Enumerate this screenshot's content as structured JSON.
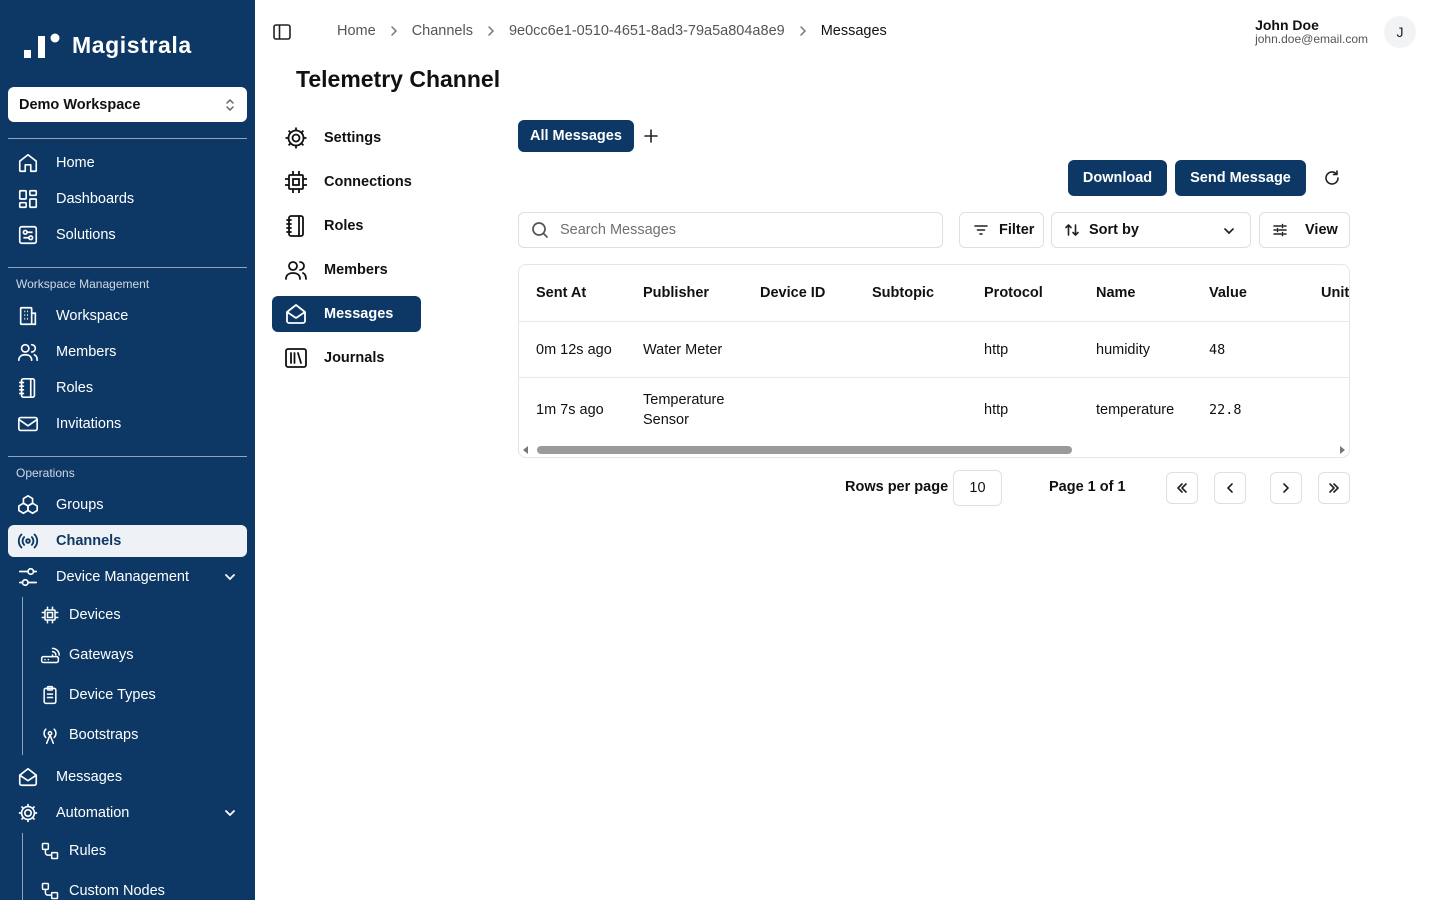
{
  "app": {
    "name": "Magistrala"
  },
  "workspace": {
    "selected": "Demo Workspace"
  },
  "sidebar": {
    "main_items": [
      {
        "label": "Home",
        "icon": "home-icon"
      },
      {
        "label": "Dashboards",
        "icon": "dashboards-icon"
      },
      {
        "label": "Solutions",
        "icon": "solutions-icon"
      }
    ],
    "workspace_section": "Workspace Management",
    "workspace_items": [
      {
        "label": "Workspace",
        "icon": "building-icon"
      },
      {
        "label": "Members",
        "icon": "users-icon"
      },
      {
        "label": "Roles",
        "icon": "notebook-icon"
      },
      {
        "label": "Invitations",
        "icon": "mail-icon"
      }
    ],
    "operations_section": "Operations",
    "operations_items": [
      {
        "label": "Groups",
        "icon": "boxes-icon"
      },
      {
        "label": "Channels",
        "icon": "radio-icon",
        "active": true
      },
      {
        "label": "Device Management",
        "icon": "sliders-icon",
        "expanded": true
      }
    ],
    "device_items": [
      {
        "label": "Devices",
        "icon": "chip-icon"
      },
      {
        "label": "Gateways",
        "icon": "router-icon"
      },
      {
        "label": "Device Types",
        "icon": "clipboard-icon"
      },
      {
        "label": "Bootstraps",
        "icon": "antenna-icon"
      }
    ],
    "bottom_items": [
      {
        "label": "Messages",
        "icon": "mail-open-icon"
      },
      {
        "label": "Automation",
        "icon": "cog-icon",
        "expanded": true
      }
    ],
    "automation_items": [
      {
        "label": "Rules",
        "icon": "workflow-icon"
      },
      {
        "label": "Custom Nodes",
        "icon": "workflow-icon"
      }
    ]
  },
  "breadcrumb": [
    "Home",
    "Channels",
    "9e0cc6e1-0510-4651-8ad3-79a5a804a8e9",
    "Messages"
  ],
  "user": {
    "name": "John Doe",
    "email": "john.doe@email.com",
    "initial": "J"
  },
  "page": {
    "title": "Telemetry Channel"
  },
  "channel_nav": [
    {
      "label": "Settings",
      "icon": "gear-icon"
    },
    {
      "label": "Connections",
      "icon": "chip-icon"
    },
    {
      "label": "Roles",
      "icon": "notebook-icon"
    },
    {
      "label": "Members",
      "icon": "users-icon"
    },
    {
      "label": "Messages",
      "icon": "mail-open-icon",
      "active": true
    },
    {
      "label": "Journals",
      "icon": "library-icon"
    }
  ],
  "tabs": {
    "active": "All Messages",
    "add_icon": "plus-icon"
  },
  "actions": {
    "download": "Download",
    "send": "Send Message",
    "refresh_icon": "refresh-icon"
  },
  "toolbar": {
    "search_placeholder": "Search Messages",
    "filter": "Filter",
    "sort": "Sort by",
    "view": "View"
  },
  "table": {
    "columns": [
      "Sent At",
      "Publisher",
      "Device ID",
      "Subtopic",
      "Protocol",
      "Name",
      "Value",
      "Unit"
    ],
    "rows": [
      {
        "sent_at": "0m 12s ago",
        "publisher": "Water Meter",
        "device_id": "",
        "subtopic": "",
        "protocol": "http",
        "name": "humidity",
        "value": "48",
        "unit": ""
      },
      {
        "sent_at": "1m 7s ago",
        "publisher": "Temperature Sensor",
        "device_id": "",
        "subtopic": "",
        "protocol": "http",
        "name": "temperature",
        "value": "22.8",
        "unit": ""
      }
    ]
  },
  "pagination": {
    "rows_per_page_label": "Rows per page",
    "rows_per_page": "10",
    "page_info": "Page 1 of 1"
  },
  "colors": {
    "brand": "#0d3865",
    "active_bg": "#eef2f6"
  }
}
